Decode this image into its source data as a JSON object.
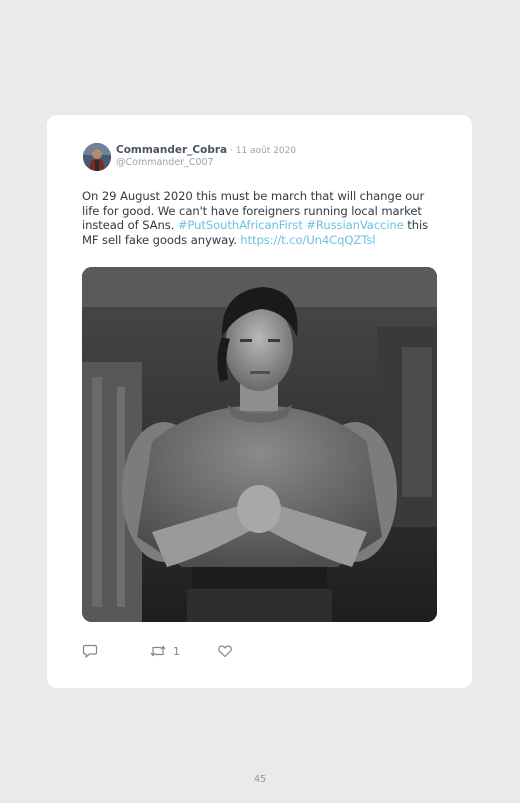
{
  "tweet": {
    "display_name": "Commander_Cobra",
    "separator": " · ",
    "date": "11 août 2020",
    "handle": "@Commander_C007",
    "text_parts": {
      "p1": "On 29 August 2020 this must be march that will change our life for good. We can't have foreigners running local market instead of SAns. ",
      "hashtag1": "#PutSouthAfricanFirst",
      "space": " ",
      "hashtag2": "#RussianVaccine",
      "p2": " this MF sell fake goods anyway. ",
      "link": "https://t.co/Un4CqQZTsl"
    },
    "retweet_count": "1"
  },
  "icons": {
    "reply": "reply-icon",
    "retweet": "retweet-icon",
    "like": "heart-icon"
  },
  "colors": {
    "background": "#ebeae8",
    "card": "#ffffff",
    "link": "#6cc0e6",
    "muted": "#9aa3ad"
  },
  "footer": {
    "page_number": "45"
  }
}
